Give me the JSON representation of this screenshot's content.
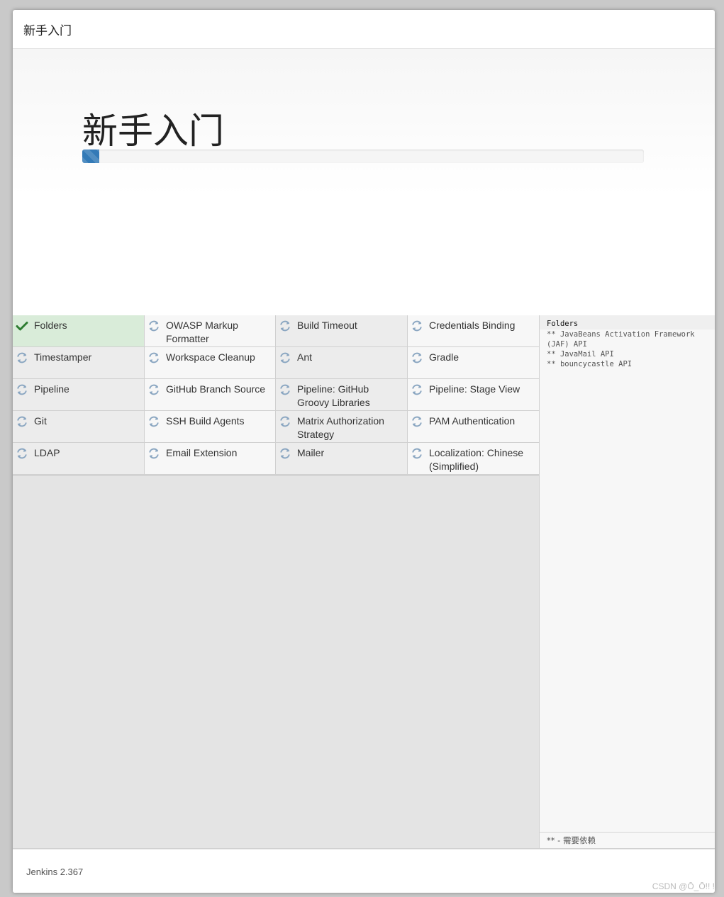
{
  "header": {
    "title": "新手入门"
  },
  "hero": {
    "title": "新手入门",
    "progress_percent": 3
  },
  "plugins": [
    {
      "name": "Folders",
      "status": "done"
    },
    {
      "name": "OWASP Markup Formatter",
      "status": "pending"
    },
    {
      "name": "Build Timeout",
      "status": "pending"
    },
    {
      "name": "Credentials Binding",
      "status": "pending"
    },
    {
      "name": "Timestamper",
      "status": "pending"
    },
    {
      "name": "Workspace Cleanup",
      "status": "pending"
    },
    {
      "name": "Ant",
      "status": "pending"
    },
    {
      "name": "Gradle",
      "status": "pending"
    },
    {
      "name": "Pipeline",
      "status": "pending"
    },
    {
      "name": "GitHub Branch Source",
      "status": "pending"
    },
    {
      "name": "Pipeline: GitHub Groovy Libraries",
      "status": "pending"
    },
    {
      "name": "Pipeline: Stage View",
      "status": "pending"
    },
    {
      "name": "Git",
      "status": "pending"
    },
    {
      "name": "SSH Build Agents",
      "status": "pending"
    },
    {
      "name": "Matrix Authorization Strategy",
      "status": "pending"
    },
    {
      "name": "PAM Authentication",
      "status": "pending"
    },
    {
      "name": "LDAP",
      "status": "pending"
    },
    {
      "name": "Email Extension",
      "status": "pending"
    },
    {
      "name": "Mailer",
      "status": "pending"
    },
    {
      "name": "Localization: Chinese (Simplified)",
      "status": "pending"
    }
  ],
  "log": {
    "current": "Folders",
    "lines": [
      "** JavaBeans Activation Framework (JAF) API",
      "** JavaMail API",
      "** bouncycastle API"
    ],
    "footnote": "** - 需要依赖"
  },
  "footer": {
    "version": "Jenkins 2.367"
  },
  "watermark": "CSDN @Ō_Ō!! !",
  "colors": {
    "accent": "#337ab7",
    "done_bg": "#d9ecd9",
    "check": "#2e7d32",
    "spinner": "#8aa6c1"
  }
}
